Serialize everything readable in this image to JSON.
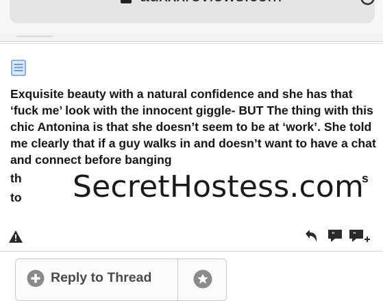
{
  "browser": {
    "url": "auxxxreviews.com",
    "menu_icon": "hamburger-icon",
    "lock_icon": "lock-icon",
    "reload_icon": "reload-icon"
  },
  "post": {
    "doc_icon": "document-icon",
    "body": "Exquisite beauty with a natural confidence and she has that ‘fuck me’ look with the innocent giggle- BUT The thing with this chic Antonina is that she doesn’t seem to be at ‘work’. She told me clearly that if a guy walks in and doesn’t want to have a chat and connect before banging",
    "truncated_line_1_left": "th",
    "truncated_line_1_right": "s",
    "truncated_line_2_left": "to",
    "watermark": "SecretHostess.com"
  },
  "actions": {
    "report_icon": "warning-icon",
    "reply_icon": "reply-arrow-icon",
    "quote_icon": "quote-icon",
    "multiquote_icon": "multi-quote-icon"
  },
  "reply_bar": {
    "reply_label": "Reply to Thread",
    "plus_icon": "plus-circle-icon",
    "star_icon": "star-icon"
  },
  "colors": {
    "chrome_bg": "#f7f7f7",
    "url_pill": "#e4e4e6",
    "text": "#151515",
    "icon_gray": "#8a8a8a",
    "doc_blue": "#6a9ad8"
  }
}
